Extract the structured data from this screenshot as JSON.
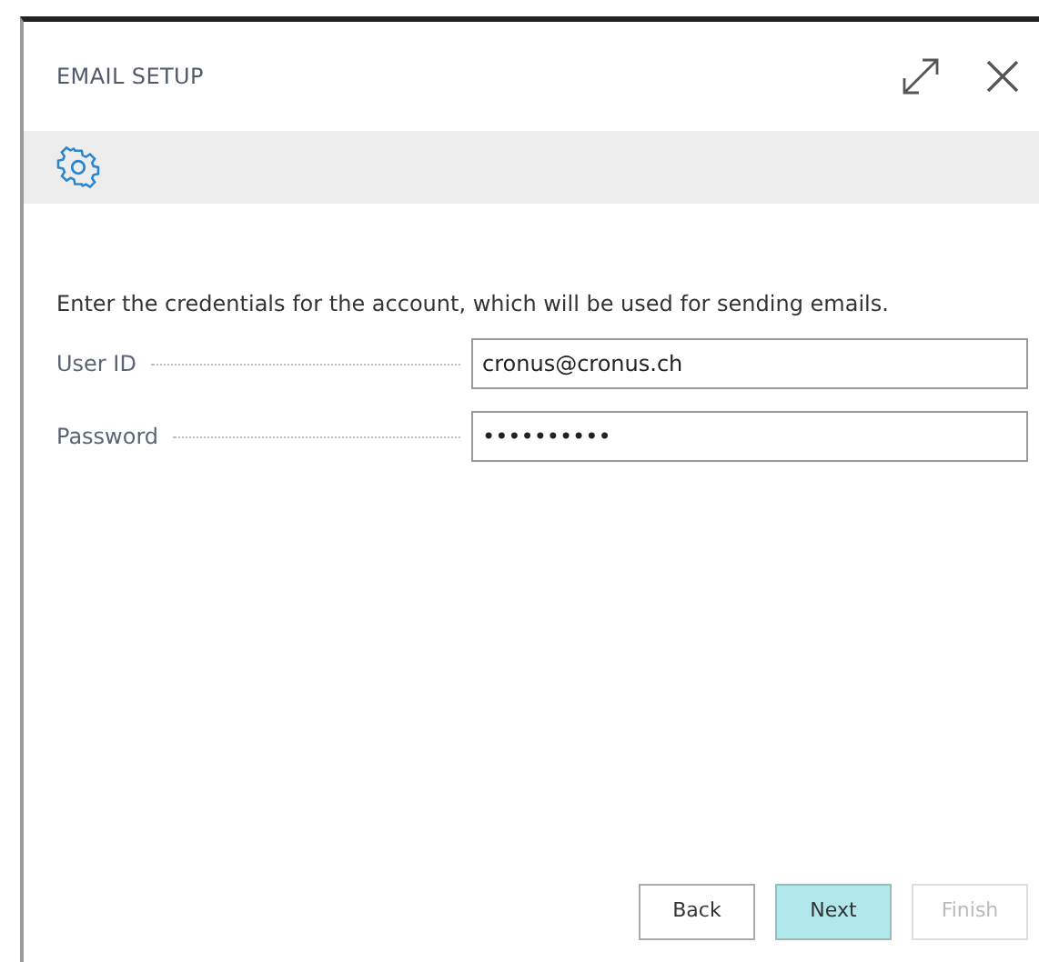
{
  "dialog": {
    "title": "EMAIL SETUP"
  },
  "instruction": "Enter the credentials for the account, which will be used for sending emails.",
  "fields": [
    {
      "label": "User ID",
      "value": "cronus@cronus.ch"
    },
    {
      "label": "Password",
      "value": "••••••••••"
    }
  ],
  "buttons": [
    {
      "label": "Back",
      "primary": false,
      "disabled": false
    },
    {
      "label": "Next",
      "primary": true,
      "disabled": false
    },
    {
      "label": "Finish",
      "primary": false,
      "disabled": true
    }
  ]
}
